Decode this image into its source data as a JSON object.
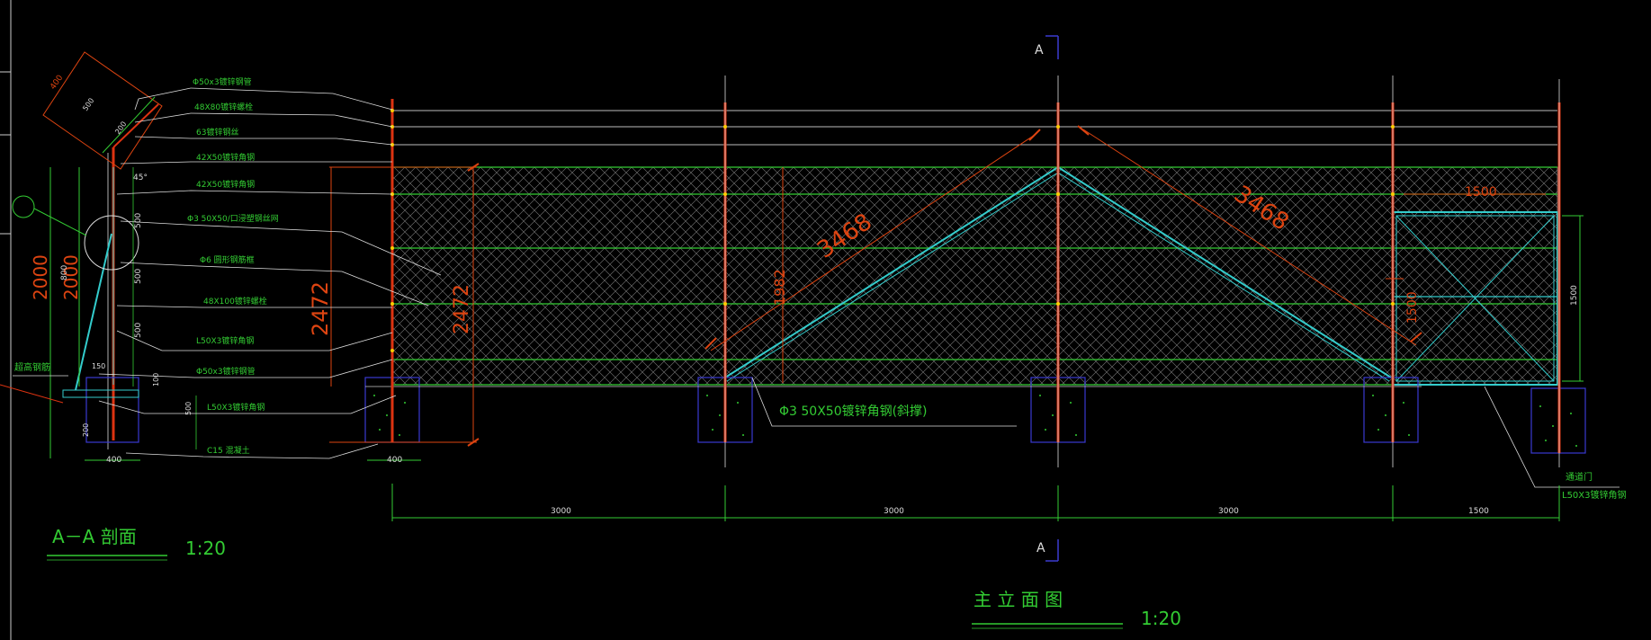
{
  "section_marks": {
    "top": "A",
    "bottom": "A"
  },
  "section_view": {
    "title": "A－A 剖面",
    "scale": "1:20",
    "labels": [
      "Φ50x3镀锌钢管",
      "48X80镀锌螺栓",
      "63镀锌钢丝",
      "42X50镀锌角钢",
      "42X50镀锌角钢",
      "Φ3 50X50/口浸塑钢丝网",
      "Φ6 圆形钢筋框",
      "48X100镀锌螺栓",
      "L50X3镀锌角钢",
      "Φ50x3镀锌钢管",
      "L50X3镀锌角钢",
      "C15 混凝土"
    ],
    "left_label": "超高钢筋",
    "dims": {
      "h_2000_a": "2000",
      "h_2000_b": "2000",
      "h_2472": "2472",
      "d_800": "800",
      "d_500_a": "500",
      "d_500_b": "500",
      "d_500_c": "500",
      "d_400_a": "400",
      "d_400_b": "400",
      "angle_45": "45°",
      "t_150": "150",
      "t_500": "500",
      "t_200": "200",
      "t_100": "100",
      "t_400": "400",
      "t_200b": "200",
      "t_500b": "500"
    }
  },
  "elevation": {
    "title": "主 立 面 图",
    "scale": "1:20",
    "brace_label": "Φ3 50X50镀锌角钢(斜撑)",
    "height_label": "2472",
    "diag_1": "3468",
    "diag_2": "3468",
    "height_1982": "1982",
    "gate_width": "1500",
    "gate_height": "1500",
    "gate_side": "1500",
    "gate_note_1": "通道门",
    "gate_note_2": "L50X3镀锌角钢",
    "spans": [
      "3000",
      "3000",
      "3000",
      "1500"
    ]
  }
}
